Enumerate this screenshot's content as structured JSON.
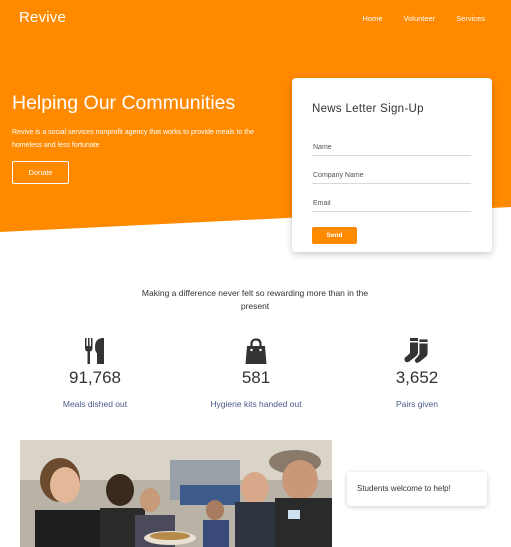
{
  "brand": {
    "name": "Revive"
  },
  "nav": {
    "items": [
      "Home",
      "Volunteer",
      "Services"
    ]
  },
  "colors": {
    "accent": "#ff8a00",
    "label_text": "#4a5a8a"
  },
  "hero": {
    "title": "Helping Our Communities",
    "description": "Revive is a social services nonprofit agency that works to provide meals to the homeless and less fortunate",
    "donate_label": "Donate"
  },
  "signup": {
    "title": "News Letter Sign-Up",
    "name_placeholder": "Name",
    "company_placeholder": "Company Name",
    "email_placeholder": "Email",
    "send_label": "Send"
  },
  "tagline": "Making a difference never felt so rewarding more than in the present",
  "stats": [
    {
      "icon": "utensils-icon",
      "value": "91,768",
      "label": "Meals dished out"
    },
    {
      "icon": "shopping-bag-icon",
      "value": "581",
      "label": "Hygiene kits handed out"
    },
    {
      "icon": "socks-icon",
      "value": "3,652",
      "label": "Pairs given"
    }
  ],
  "caption": "Students welcome to help!"
}
